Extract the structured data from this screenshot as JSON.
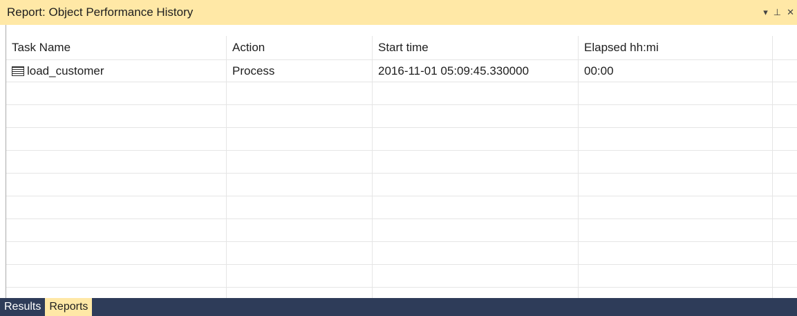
{
  "window": {
    "title": "Report: Object Performance History",
    "tools": {
      "dropdown": "▾",
      "pin": "⊥",
      "close": "✕"
    }
  },
  "grid": {
    "columns": [
      "Task Name",
      "Action",
      "Start time",
      "Elapsed hh:mi"
    ],
    "rows": [
      {
        "task_name": "load_customer",
        "action": "Process",
        "start_time": "2016-11-01 05:09:45.330000",
        "elapsed": "00:00"
      }
    ]
  },
  "tabs": [
    {
      "label": "Results",
      "active": false
    },
    {
      "label": "Reports",
      "active": true
    }
  ],
  "colors": {
    "title_bg": "#ffe8a6",
    "tabbar_bg": "#2e3c59"
  }
}
